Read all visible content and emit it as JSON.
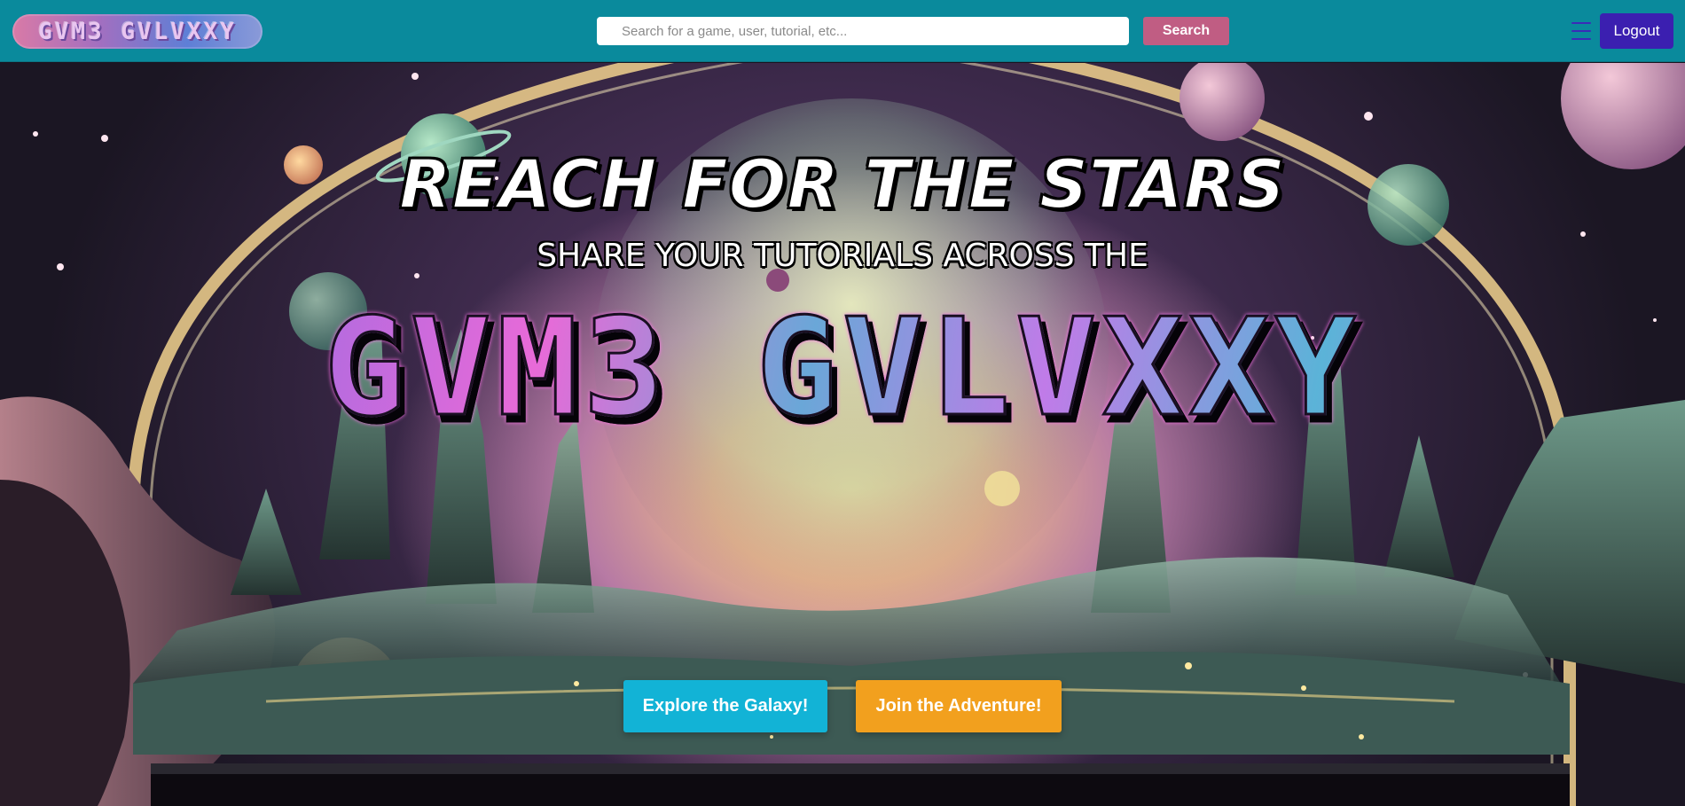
{
  "navbar": {
    "logo_text": "GVM3 GVLVXXY",
    "search": {
      "placeholder": "Search for a game, user, tutorial, etc...",
      "value": ""
    },
    "search_button": "Search",
    "menu_icon": "hamburger-menu-icon",
    "logout_button": "Logout"
  },
  "hero": {
    "headline": "REACH FOR THE STARS",
    "subheadline": "SHARE YOUR TUTORIALS ACROSS THE",
    "title": "GVM3 GVLVXXY",
    "buttons": {
      "explore": "Explore the Galaxy!",
      "join": "Join the Adventure!"
    }
  },
  "colors": {
    "navbar_bg": "#0a8a9c",
    "search_button_bg": "#c05d83",
    "logout_button_bg": "#3b1fb0",
    "explore_button_bg": "#12b3d6",
    "join_button_bg": "#f2a01e"
  }
}
